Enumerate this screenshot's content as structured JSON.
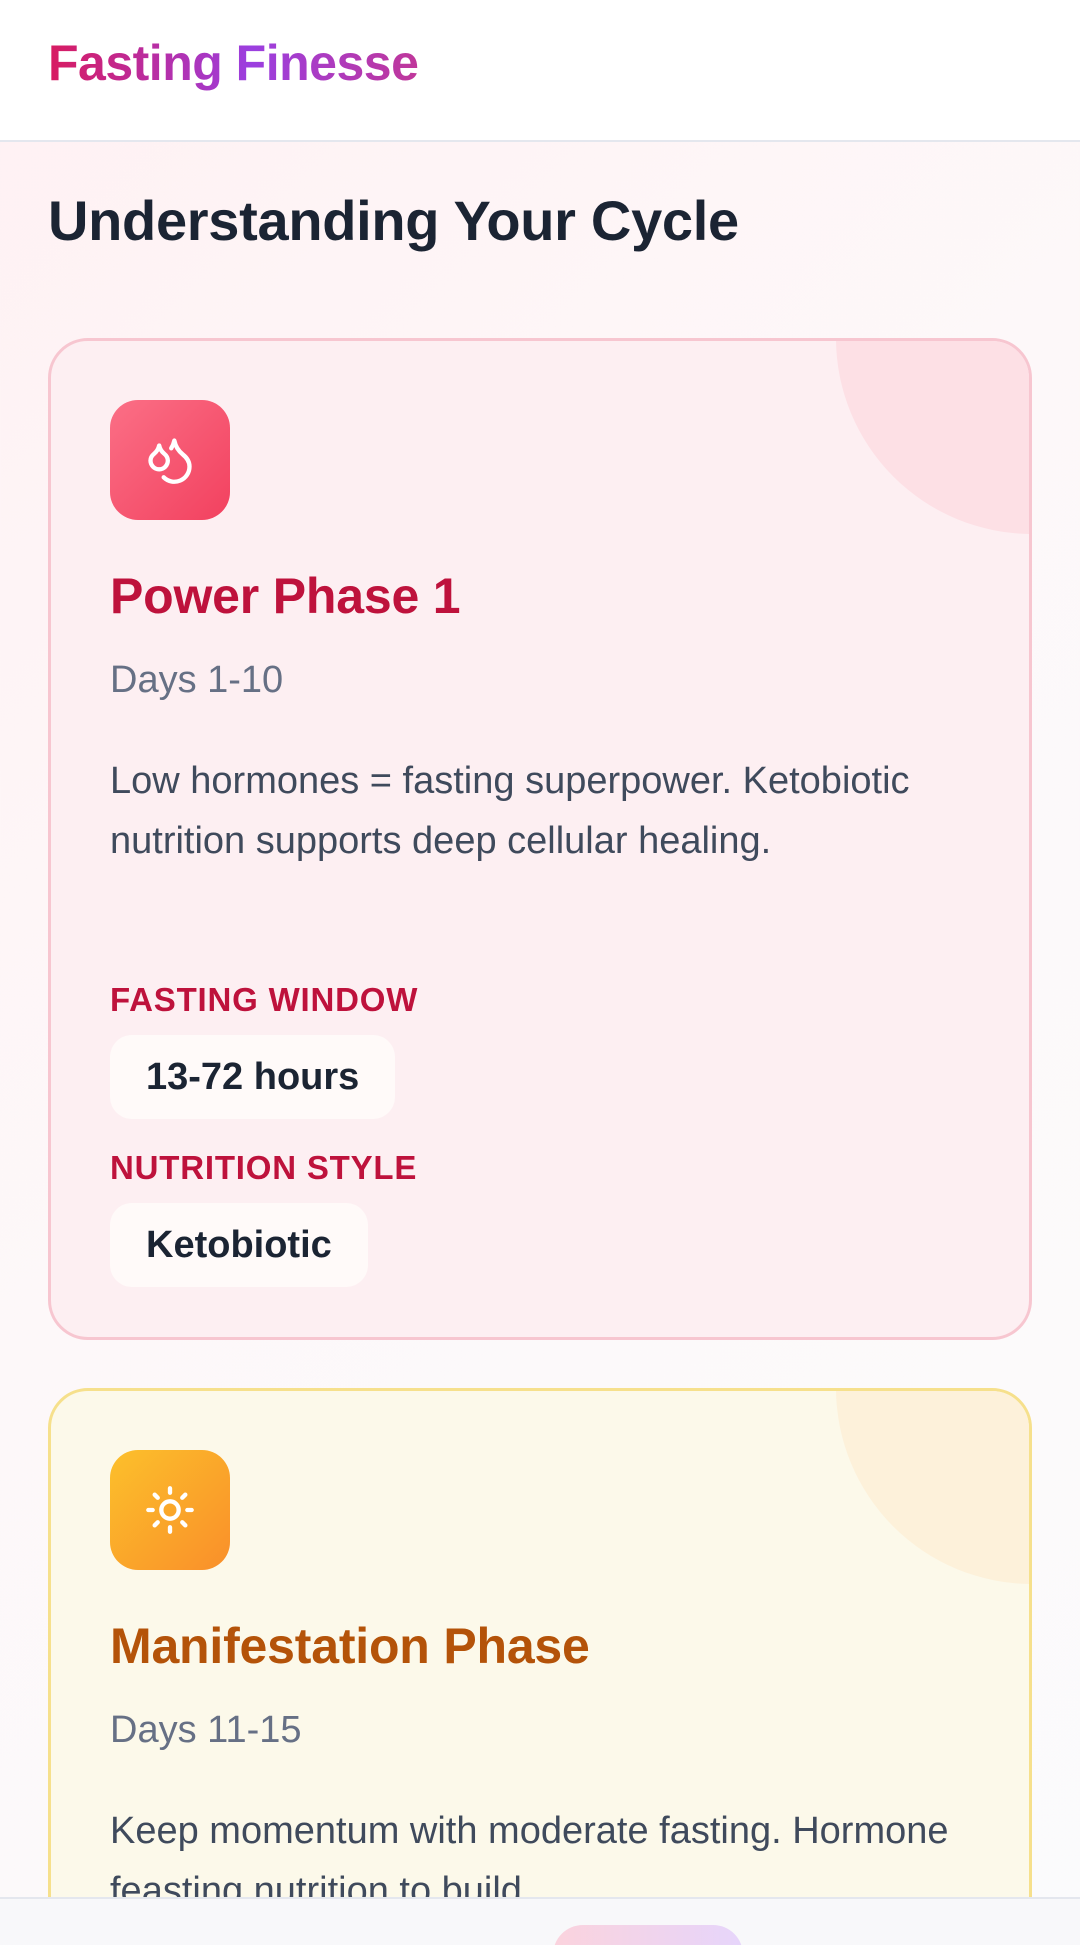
{
  "header": {
    "brand": "Fasting Finesse"
  },
  "page": {
    "title": "Understanding Your Cycle"
  },
  "phases": [
    {
      "title": "Power Phase 1",
      "days": "Days 1-10",
      "description": "Low hormones = fasting superpower. Ketobiotic nutrition supports deep cellular healing.",
      "fasting_label": "FASTING WINDOW",
      "fasting_value": "13-72 hours",
      "nutrition_label": "NUTRITION STYLE",
      "nutrition_value": "Ketobiotic",
      "icon": "drops-icon",
      "accent": "#be123c"
    },
    {
      "title": "Manifestation Phase",
      "days": "Days 11-15",
      "description": "Keep momentum with moderate fasting. Hormone feasting nutrition to build",
      "icon": "sun-icon",
      "accent": "#b45309"
    }
  ]
}
